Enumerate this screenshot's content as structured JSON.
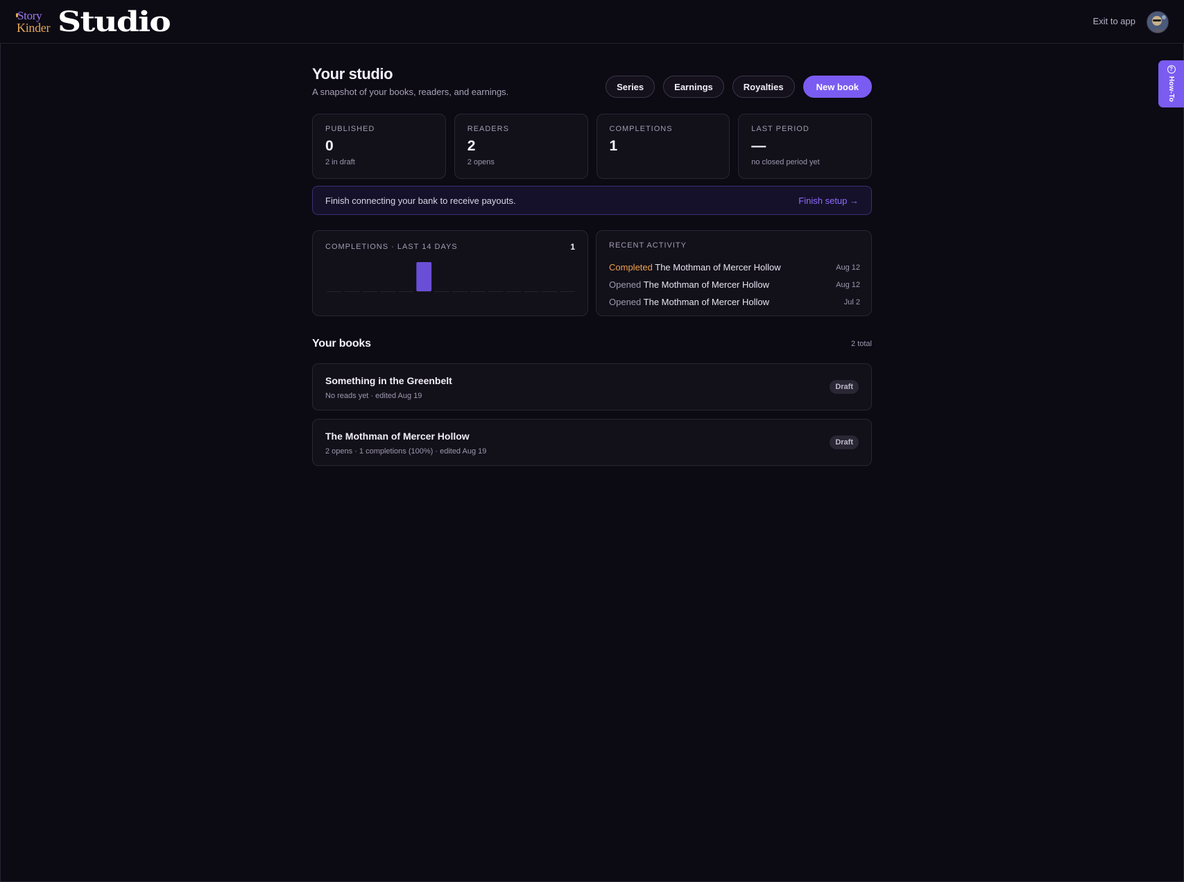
{
  "header": {
    "logo_top": "Story",
    "logo_bottom": "Kinder",
    "logo_word": "Studio",
    "exit_label": "Exit to app",
    "howto_label": "How-To"
  },
  "page": {
    "title": "Your studio",
    "subtitle": "A snapshot of your books, readers, and earnings."
  },
  "actions": {
    "series": "Series",
    "earnings": "Earnings",
    "royalties": "Royalties",
    "new_book": "New book"
  },
  "stats": [
    {
      "label": "PUBLISHED",
      "value": "0",
      "sub": "2 in draft"
    },
    {
      "label": "READERS",
      "value": "2",
      "sub": "2 opens"
    },
    {
      "label": "COMPLETIONS",
      "value": "1",
      "sub": ""
    },
    {
      "label": "LAST PERIOD",
      "value": "—",
      "sub": "no closed period yet"
    }
  ],
  "banner": {
    "message": "Finish connecting your bank to receive payouts.",
    "cta": "Finish setup →"
  },
  "completions_panel": {
    "title": "COMPLETIONS · LAST 14 DAYS",
    "total": "1"
  },
  "chart_data": {
    "type": "bar",
    "title": "COMPLETIONS · LAST 14 DAYS",
    "values": [
      0,
      0,
      0,
      0,
      0,
      1,
      0,
      0,
      0,
      0,
      0,
      0,
      0,
      0
    ],
    "ylim": [
      0,
      1
    ],
    "color": "#6a4fd6",
    "grid": false
  },
  "activity": {
    "title": "RECENT ACTIVITY",
    "items": [
      {
        "verb": "Completed",
        "book": "The Mothman of Mercer Hollow",
        "date": "Aug 12"
      },
      {
        "verb": "Opened",
        "book": "The Mothman of Mercer Hollow",
        "date": "Aug 12"
      },
      {
        "verb": "Opened",
        "book": "The Mothman of Mercer Hollow",
        "date": "Jul 2"
      }
    ]
  },
  "books": {
    "title": "Your books",
    "count": "2 total",
    "items": [
      {
        "title": "Something in the Greenbelt",
        "meta": "No reads yet · edited Aug 19",
        "status": "Draft"
      },
      {
        "title": "The Mothman of Mercer Hollow",
        "meta": "2 opens · 1 completions (100%) · edited Aug 19",
        "status": "Draft"
      }
    ]
  },
  "colors": {
    "background": "#0c0a13",
    "accent": "#7b5cf2",
    "completed": "#f0a24f"
  }
}
